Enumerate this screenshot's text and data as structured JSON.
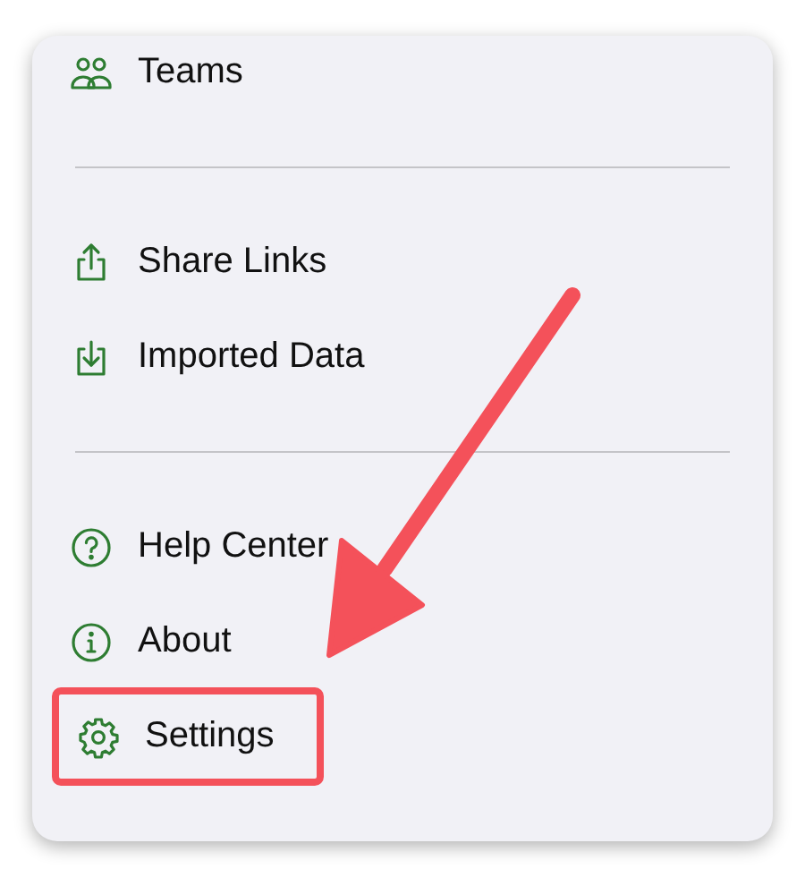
{
  "menu": {
    "sections": [
      {
        "items": [
          {
            "label": "Teams",
            "kind": "people",
            "highlighted": false
          }
        ]
      },
      {
        "items": [
          {
            "label": "Share Links",
            "kind": "share",
            "highlighted": false
          },
          {
            "label": "Imported Data",
            "kind": "import",
            "highlighted": false
          }
        ]
      },
      {
        "items": [
          {
            "label": "Help Center",
            "kind": "help",
            "highlighted": false
          },
          {
            "label": "About",
            "kind": "info",
            "highlighted": false
          },
          {
            "label": "Settings",
            "kind": "gear",
            "highlighted": true
          }
        ]
      }
    ]
  }
}
